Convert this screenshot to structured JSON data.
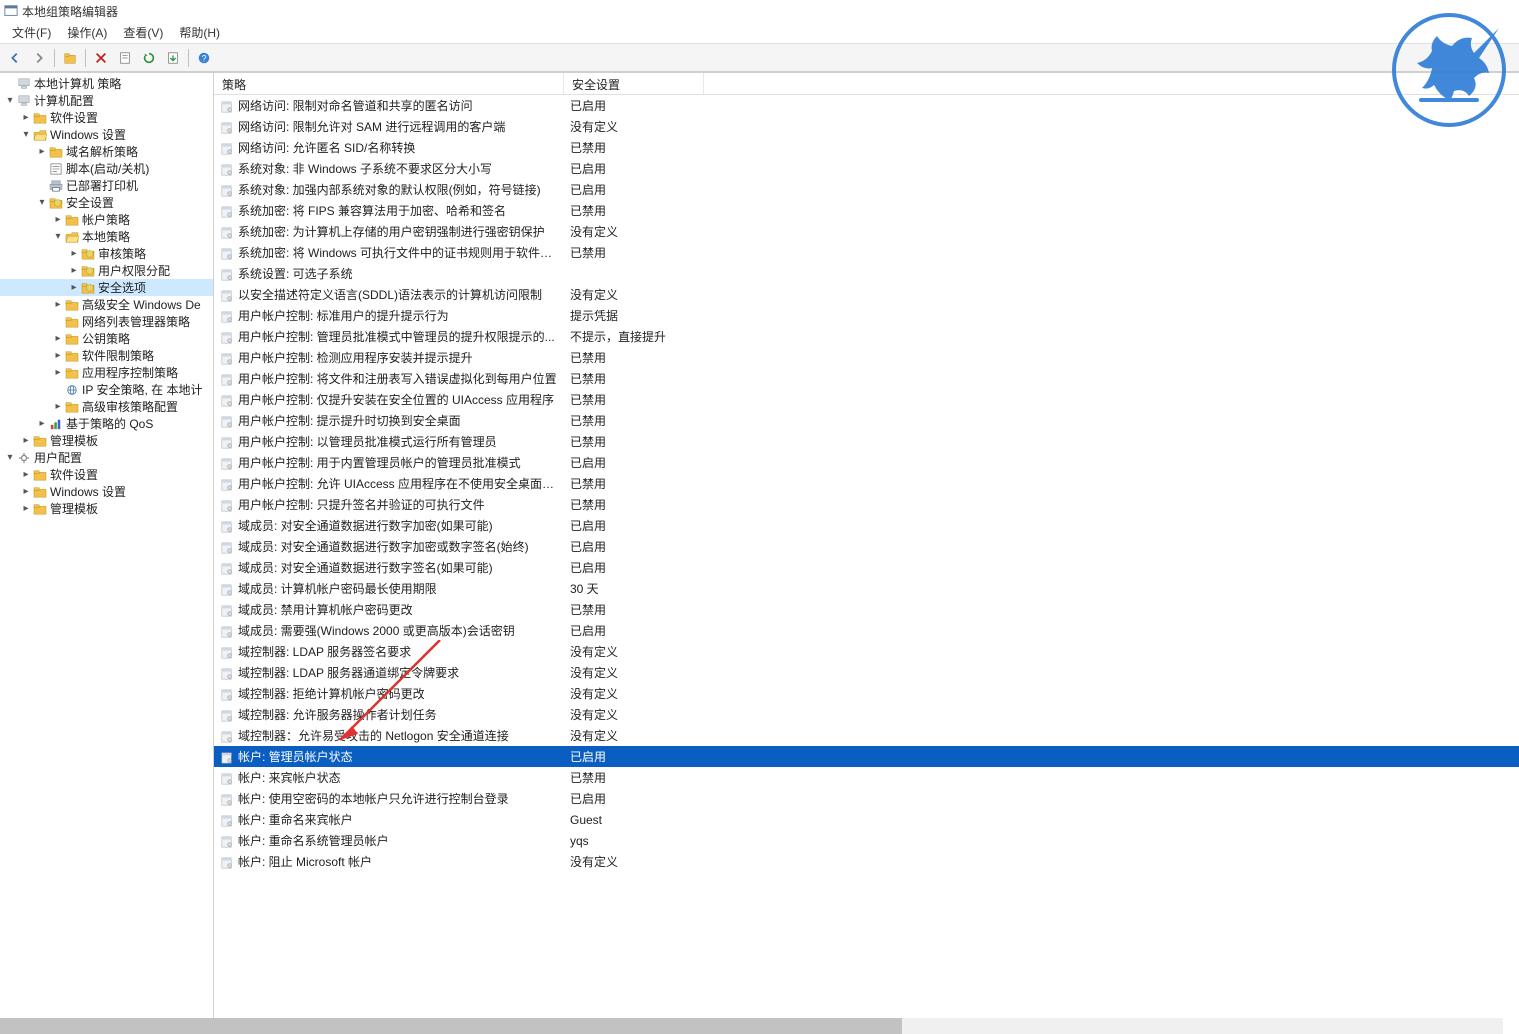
{
  "window": {
    "title": "本地组策略编辑器"
  },
  "menus": {
    "file": "文件(F)",
    "action": "操作(A)",
    "view": "查看(V)",
    "help": "帮助(H)"
  },
  "tree": {
    "root": "本地计算机 策略",
    "computer_config": "计算机配置",
    "software_settings": "软件设置",
    "windows_settings": "Windows 设置",
    "dns_policy": "域名解析策略",
    "scripts": "脚本(启动/关机)",
    "deployed_printers": "已部署打印机",
    "security_settings": "安全设置",
    "account_policies": "帐户策略",
    "local_policies": "本地策略",
    "audit_policy": "审核策略",
    "user_rights": "用户权限分配",
    "security_options": "安全选项",
    "advanced_firewall": "高级安全 Windows De",
    "network_list": "网络列表管理器策略",
    "public_key": "公钥策略",
    "software_restriction": "软件限制策略",
    "app_control": "应用程序控制策略",
    "ip_security": "IP 安全策略, 在 本地计",
    "advanced_audit": "高级审核策略配置",
    "qos": "基于策略的 QoS",
    "admin_templates_c": "管理模板",
    "user_config": "用户配置",
    "software_settings_u": "软件设置",
    "windows_settings_u": "Windows 设置",
    "admin_templates_u": "管理模板"
  },
  "list": {
    "header_policy": "策略",
    "header_setting": "安全设置",
    "rows": [
      {
        "p": "网络访问: 限制对命名管道和共享的匿名访问",
        "s": "已启用"
      },
      {
        "p": "网络访问: 限制允许对 SAM 进行远程调用的客户端",
        "s": "没有定义"
      },
      {
        "p": "网络访问: 允许匿名 SID/名称转换",
        "s": "已禁用"
      },
      {
        "p": "系统对象: 非 Windows 子系统不要求区分大小写",
        "s": "已启用"
      },
      {
        "p": "系统对象: 加强内部系统对象的默认权限(例如，符号链接)",
        "s": "已启用"
      },
      {
        "p": "系统加密: 将 FIPS 兼容算法用于加密、哈希和签名",
        "s": "已禁用"
      },
      {
        "p": "系统加密: 为计算机上存储的用户密钥强制进行强密钥保护",
        "s": "没有定义"
      },
      {
        "p": "系统加密: 将 Windows 可执行文件中的证书规则用于软件限...",
        "s": "已禁用"
      },
      {
        "p": "系统设置: 可选子系统",
        "s": ""
      },
      {
        "p": "以安全描述符定义语言(SDDL)语法表示的计算机访问限制",
        "s": "没有定义"
      },
      {
        "p": "用户帐户控制: 标准用户的提升提示行为",
        "s": "提示凭据"
      },
      {
        "p": "用户帐户控制: 管理员批准模式中管理员的提升权限提示的...",
        "s": "不提示，直接提升"
      },
      {
        "p": "用户帐户控制: 检测应用程序安装并提示提升",
        "s": "已禁用"
      },
      {
        "p": "用户帐户控制: 将文件和注册表写入错误虚拟化到每用户位置",
        "s": "已禁用"
      },
      {
        "p": "用户帐户控制: 仅提升安装在安全位置的 UIAccess 应用程序",
        "s": "已禁用"
      },
      {
        "p": "用户帐户控制: 提示提升时切换到安全桌面",
        "s": "已禁用"
      },
      {
        "p": "用户帐户控制: 以管理员批准模式运行所有管理员",
        "s": "已禁用"
      },
      {
        "p": "用户帐户控制: 用于内置管理员帐户的管理员批准模式",
        "s": "已启用"
      },
      {
        "p": "用户帐户控制: 允许 UIAccess 应用程序在不使用安全桌面的...",
        "s": "已禁用"
      },
      {
        "p": "用户帐户控制: 只提升签名并验证的可执行文件",
        "s": "已禁用"
      },
      {
        "p": "域成员: 对安全通道数据进行数字加密(如果可能)",
        "s": "已启用"
      },
      {
        "p": "域成员: 对安全通道数据进行数字加密或数字签名(始终)",
        "s": "已启用"
      },
      {
        "p": "域成员: 对安全通道数据进行数字签名(如果可能)",
        "s": "已启用"
      },
      {
        "p": "域成员: 计算机帐户密码最长使用期限",
        "s": "30 天"
      },
      {
        "p": "域成员: 禁用计算机帐户密码更改",
        "s": "已禁用"
      },
      {
        "p": "域成员: 需要强(Windows 2000 或更高版本)会话密钥",
        "s": "已启用"
      },
      {
        "p": "域控制器: LDAP 服务器签名要求",
        "s": "没有定义"
      },
      {
        "p": "域控制器: LDAP 服务器通道绑定令牌要求",
        "s": "没有定义"
      },
      {
        "p": "域控制器: 拒绝计算机帐户密码更改",
        "s": "没有定义"
      },
      {
        "p": "域控制器: 允许服务器操作者计划任务",
        "s": "没有定义"
      },
      {
        "p": "域控制器：允许易受攻击的 Netlogon 安全通道连接",
        "s": "没有定义"
      },
      {
        "p": "帐户: 管理员帐户状态",
        "s": "已启用",
        "sel": true
      },
      {
        "p": "帐户: 来宾帐户状态",
        "s": "已禁用"
      },
      {
        "p": "帐户: 使用空密码的本地帐户只允许进行控制台登录",
        "s": "已启用"
      },
      {
        "p": "帐户: 重命名来宾帐户",
        "s": "Guest"
      },
      {
        "p": "帐户: 重命名系统管理员帐户",
        "s": "yqs"
      },
      {
        "p": "帐户: 阻止 Microsoft 帐户",
        "s": "没有定义"
      }
    ]
  }
}
